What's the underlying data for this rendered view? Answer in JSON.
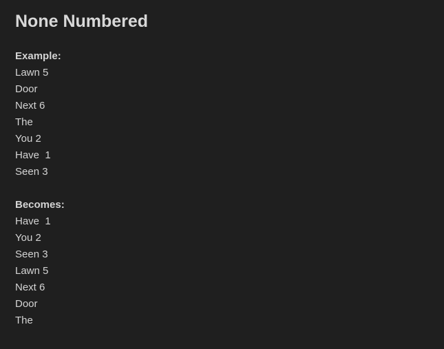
{
  "heading": "None Numbered",
  "example": {
    "label": "Example:",
    "lines": [
      "Lawn 5",
      "Door",
      "Next 6",
      "The",
      "You 2",
      "Have  1",
      "Seen 3"
    ]
  },
  "becomes": {
    "label": "Becomes:",
    "lines": [
      "Have  1",
      "You 2",
      "Seen 3",
      "Lawn 5",
      "Next 6",
      "Door",
      "The"
    ]
  }
}
